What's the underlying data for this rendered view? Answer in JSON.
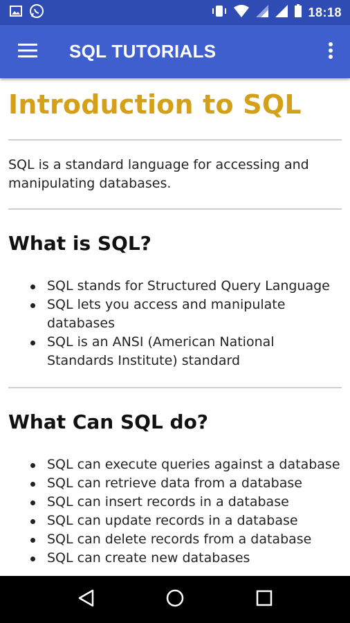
{
  "status_bar": {
    "time": "18:18",
    "icons": [
      "image-icon",
      "whatsapp-icon",
      "vibrate-icon",
      "wifi-icon",
      "signal-icon",
      "signal-icon",
      "battery-icon"
    ]
  },
  "app_bar": {
    "title": "SQL TUTORIALS",
    "menu_icon": "hamburger-menu-icon",
    "more_icon": "more-vert-icon"
  },
  "content": {
    "title": "Introduction to SQL",
    "intro": "SQL is a standard language for accessing and manipulating databases.",
    "sections": [
      {
        "heading": "What is SQL?",
        "items": [
          "SQL stands for Structured Query Language",
          "SQL lets you access and manipulate databases",
          "SQL is an ANSI (American National Standards Institute) standard"
        ]
      },
      {
        "heading": "What Can SQL do?",
        "items": [
          "SQL can execute queries against a database",
          "SQL can retrieve data from a database",
          "SQL can insert records in a database",
          "SQL can update records in a database",
          "SQL can delete records from a database",
          "SQL can create new databases"
        ]
      }
    ]
  },
  "colors": {
    "status_bar": "#2f4cb4",
    "app_bar": "#3f5fcf",
    "title": "#d4a017"
  },
  "nav_bar": {
    "icons": [
      "back-icon",
      "home-icon",
      "recents-icon"
    ]
  }
}
